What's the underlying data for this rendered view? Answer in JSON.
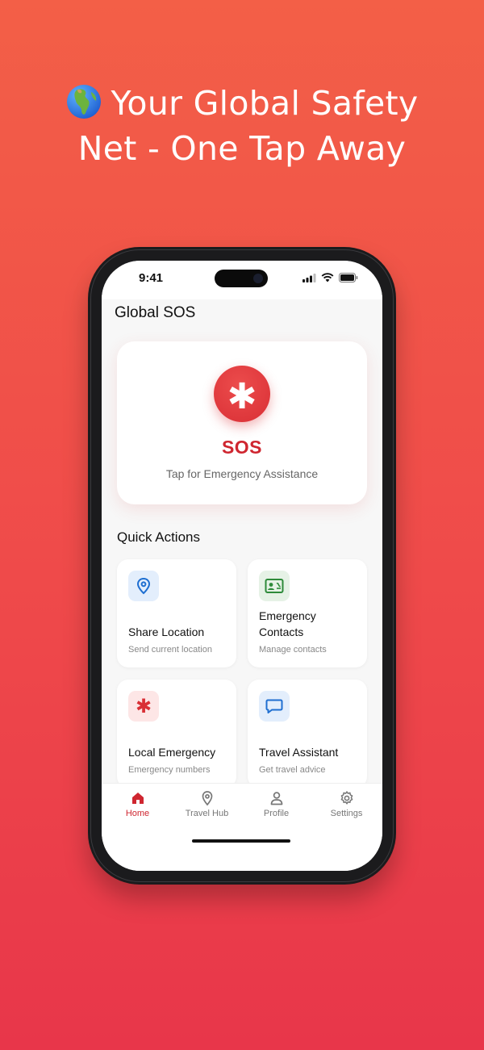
{
  "headline": {
    "line1": "Your Global Safety",
    "line2": "Net - One Tap Away"
  },
  "status": {
    "time": "9:41"
  },
  "app": {
    "title": "Global SOS"
  },
  "sos": {
    "label": "SOS",
    "subtitle": "Tap for Emergency Assistance"
  },
  "quick_actions": {
    "heading": "Quick Actions",
    "items": [
      {
        "title_l1": "Share Location",
        "title_l2": "",
        "subtitle": "Send current location",
        "icon": "location-pin-icon"
      },
      {
        "title_l1": "Emergency",
        "title_l2": "Contacts",
        "subtitle": "Manage contacts",
        "icon": "contact-card-icon"
      },
      {
        "title_l1": "Local Emergency",
        "title_l2": "",
        "subtitle": "Emergency numbers",
        "icon": "asterisk-icon"
      },
      {
        "title_l1": "Travel Assistant",
        "title_l2": "",
        "subtitle": "Get travel advice",
        "icon": "chat-bubble-icon"
      }
    ]
  },
  "tabs": [
    {
      "label": "Home",
      "icon": "home-icon",
      "active": true
    },
    {
      "label": "Travel Hub",
      "icon": "location-pin-icon",
      "active": false
    },
    {
      "label": "Profile",
      "icon": "person-icon",
      "active": false
    },
    {
      "label": "Settings",
      "icon": "gear-icon",
      "active": false
    }
  ],
  "colors": {
    "accent": "#cf2630",
    "background_top": "#f35f47",
    "background_bottom": "#e8364a"
  }
}
